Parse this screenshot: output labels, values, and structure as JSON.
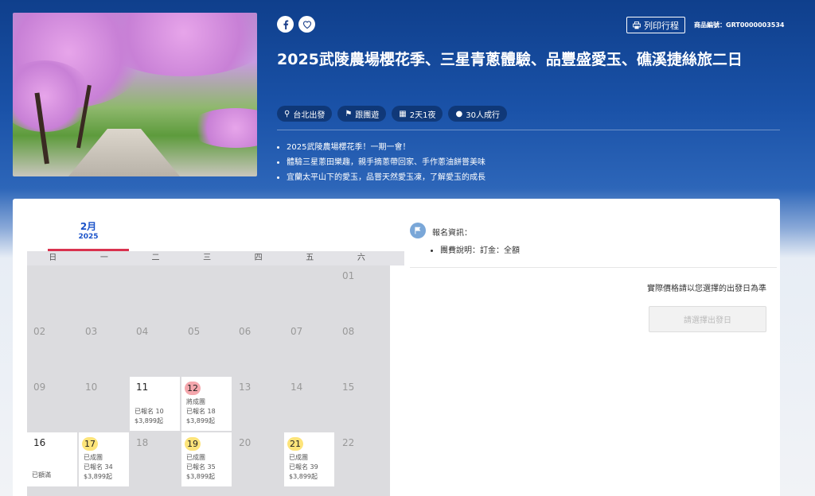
{
  "hero": {
    "product_code": "商品編號：GRT0000003534",
    "print_label": "列印行程",
    "title": "2025武陵農場櫻花季、三星青蔥體驗、品豐盛愛玉、礁溪捷絲旅二日",
    "tags": [
      "台北出發",
      "跟團遊",
      "2天1夜",
      "30人成行"
    ],
    "highlights": [
      "2025武陵農場櫻花季！一期一會！",
      "體驗三星蔥田樂趣，親手摘蔥帶回家、手作蔥油餅嘗美味",
      "宜蘭太平山下的愛玉，品嘗天然愛玉凍，了解愛玉的成長"
    ]
  },
  "calendar": {
    "month": "2月",
    "year": "2025",
    "weekdays": [
      "日",
      "一",
      "二",
      "三",
      "四",
      "五",
      "六"
    ],
    "days": [
      {
        "day": "01"
      },
      {
        "day": "02"
      },
      {
        "day": "03"
      },
      {
        "day": "04"
      },
      {
        "day": "05"
      },
      {
        "day": "06"
      },
      {
        "day": "07"
      },
      {
        "day": "08"
      },
      {
        "day": "09"
      },
      {
        "day": "10"
      },
      {
        "day": "11",
        "lines": [
          "已報名 10",
          "$3,899起"
        ]
      },
      {
        "day": "12",
        "lines": [
          "將成團",
          "已報名 18",
          "$3,899起"
        ]
      },
      {
        "day": "13"
      },
      {
        "day": "14"
      },
      {
        "day": "15"
      },
      {
        "day": "16",
        "lines": [
          "已額滿"
        ]
      },
      {
        "day": "17",
        "lines": [
          "已成團",
          "已報名 34",
          "$3,899起"
        ]
      },
      {
        "day": "18"
      },
      {
        "day": "19",
        "lines": [
          "已成團",
          "已報名 35",
          "$3,899起"
        ]
      },
      {
        "day": "20"
      },
      {
        "day": "21",
        "lines": [
          "已成團",
          "已報名 39",
          "$3,899起"
        ]
      },
      {
        "day": "22"
      }
    ]
  },
  "registration": {
    "title": "報名資訊：",
    "fee_note": "團費說明：訂金：全額",
    "price_note": "實際價格請以您選擇的出發日為準",
    "select_button": "請選擇出發日"
  },
  "colors": {
    "accent": "#1a52c9",
    "tab_underline": "#d9324f",
    "highlight_yellow": "#fde47a",
    "highlight_red": "#f5a7ad"
  }
}
